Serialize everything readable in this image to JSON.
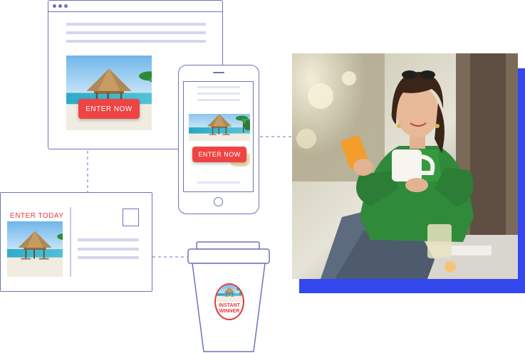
{
  "browser_mockup": {
    "cta_label": "ENTER NOW"
  },
  "phone_mockup": {
    "cta_label": "ENTER NOW"
  },
  "postcard": {
    "heading": "ENTER TODAY"
  },
  "cup": {
    "badge_line1": "INSTANT",
    "badge_line2": "WINNER"
  },
  "colors": {
    "outline": "#6b74b8",
    "cta_red": "#ef4444",
    "accent_blue": "#3347ee",
    "placeholder_lines": "#d4d6ee"
  },
  "icons": {
    "beach_photo": "tropical-beach-with-hut",
    "woman_photo": "woman-with-phone-and-coffee-mug"
  }
}
